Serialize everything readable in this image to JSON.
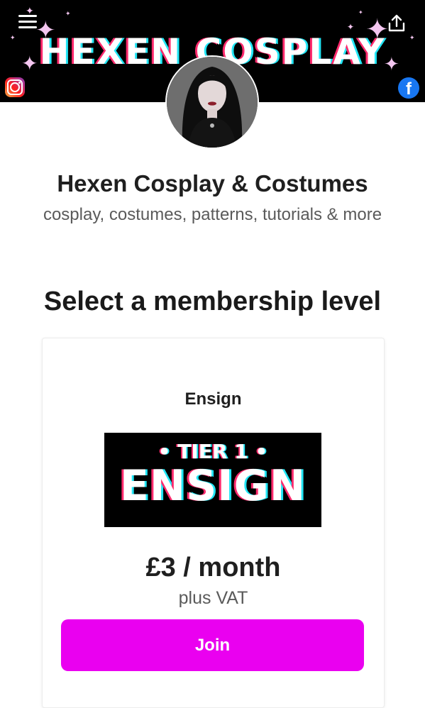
{
  "colors": {
    "accent": "#ea00f0",
    "banner_bg": "#000000",
    "facebook": "#1877f2"
  },
  "banner": {
    "title": "HEXEN COSPLAY",
    "icons": {
      "menu": "menu-icon",
      "share": "share-icon",
      "instagram": "instagram-icon",
      "facebook": "facebook-icon"
    }
  },
  "profile": {
    "name": "Hexen Cosplay & Costumes",
    "tagline": "cosplay, costumes, patterns, tutorials & more",
    "avatar_alt": "creator-avatar"
  },
  "membership": {
    "heading": "Select a membership level",
    "tiers": [
      {
        "name": "Ensign",
        "image_subtitle": "• TIER 1 •",
        "image_title": "ENSIGN",
        "price": "£3 / month",
        "price_note": "plus VAT",
        "button_label": "Join"
      }
    ]
  }
}
